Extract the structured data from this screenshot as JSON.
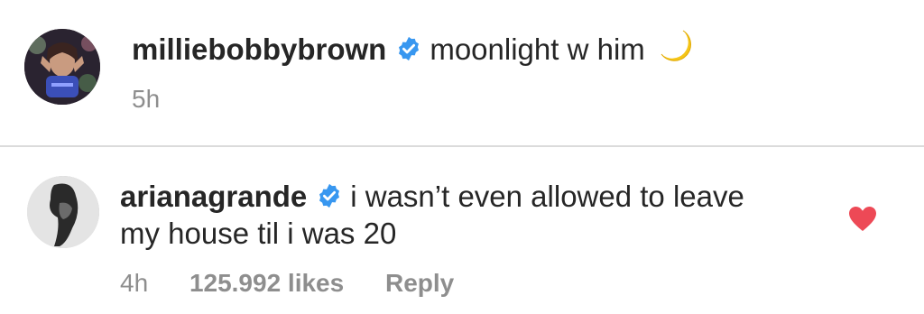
{
  "post": {
    "username": "milliebobbybrown",
    "caption": "moonlight w him",
    "time": "5h",
    "icons": {
      "verified": "verified-badge-icon",
      "moon": "crescent-moon-emoji"
    }
  },
  "comment": {
    "username": "arianagrande",
    "text_line1": "i wasn’t even allowed to leave",
    "text_line2": "my house til i was 20",
    "time": "4h",
    "likes": "125.992 likes",
    "reply_label": "Reply",
    "liked": true,
    "icons": {
      "verified": "verified-badge-icon",
      "like": "heart-icon"
    }
  },
  "colors": {
    "text": "#262626",
    "meta": "#8e8e8e",
    "verified": "#3897f0",
    "heart": "#ed4956",
    "divider": "#dbdbdb",
    "moon": "#f5c518"
  }
}
